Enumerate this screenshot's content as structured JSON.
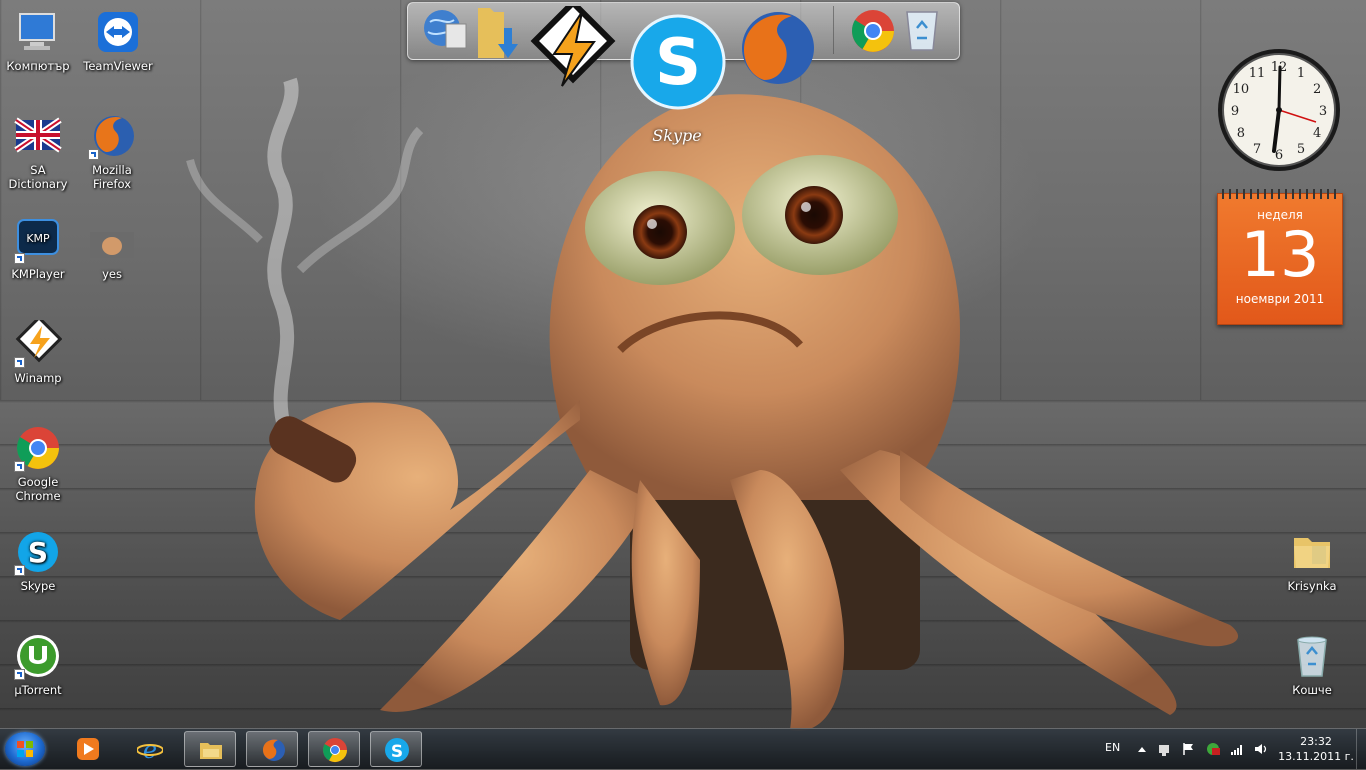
{
  "desktop": {
    "icons_left": [
      {
        "label": "Компютър",
        "icon": "computer-icon"
      },
      {
        "label": "TeamViewer",
        "icon": "teamviewer-icon"
      },
      {
        "label": "SA Dictionary",
        "icon": "uk-flag-icon"
      },
      {
        "label": "Mozilla Firefox",
        "icon": "firefox-icon"
      },
      {
        "label": "KMPlayer",
        "icon": "kmplayer-icon"
      },
      {
        "label": "yes",
        "icon": "image-thumbnail-icon"
      },
      {
        "label": "Winamp",
        "icon": "winamp-icon"
      },
      {
        "label": "Google Chrome",
        "icon": "chrome-icon"
      },
      {
        "label": "Skype",
        "icon": "skype-icon"
      },
      {
        "label": "µTorrent",
        "icon": "utorrent-icon"
      }
    ],
    "icons_right": [
      {
        "label": "Krisynka",
        "icon": "folder-icon"
      },
      {
        "label": "Кошче",
        "icon": "recycle-bin-icon"
      }
    ]
  },
  "dock": {
    "items": [
      "network-globe-icon",
      "downloads-folder-icon",
      "winamp-icon",
      "skype-icon",
      "firefox-icon",
      "chrome-icon",
      "recycle-bin-icon"
    ],
    "hover_label": "Skype"
  },
  "gadgets": {
    "clock": {
      "time": "23:32",
      "numbers": [
        "12",
        "1",
        "2",
        "3",
        "4",
        "5",
        "6",
        "7",
        "8",
        "9",
        "10",
        "11"
      ]
    },
    "calendar": {
      "weekday": "неделя",
      "day": "13",
      "month_year": "ноември 2011"
    }
  },
  "taskbar": {
    "pinned": [
      "windows-media-player-icon",
      "internet-explorer-icon",
      "windows-explorer-icon",
      "firefox-icon",
      "chrome-icon",
      "skype-icon"
    ],
    "language": "EN",
    "time": "23:32",
    "date": "13.11.2011 г."
  },
  "colors": {
    "calendar_orange": "#e2581a",
    "taskbar": "#1c2127",
    "start_orb": "#1d6ad0"
  }
}
